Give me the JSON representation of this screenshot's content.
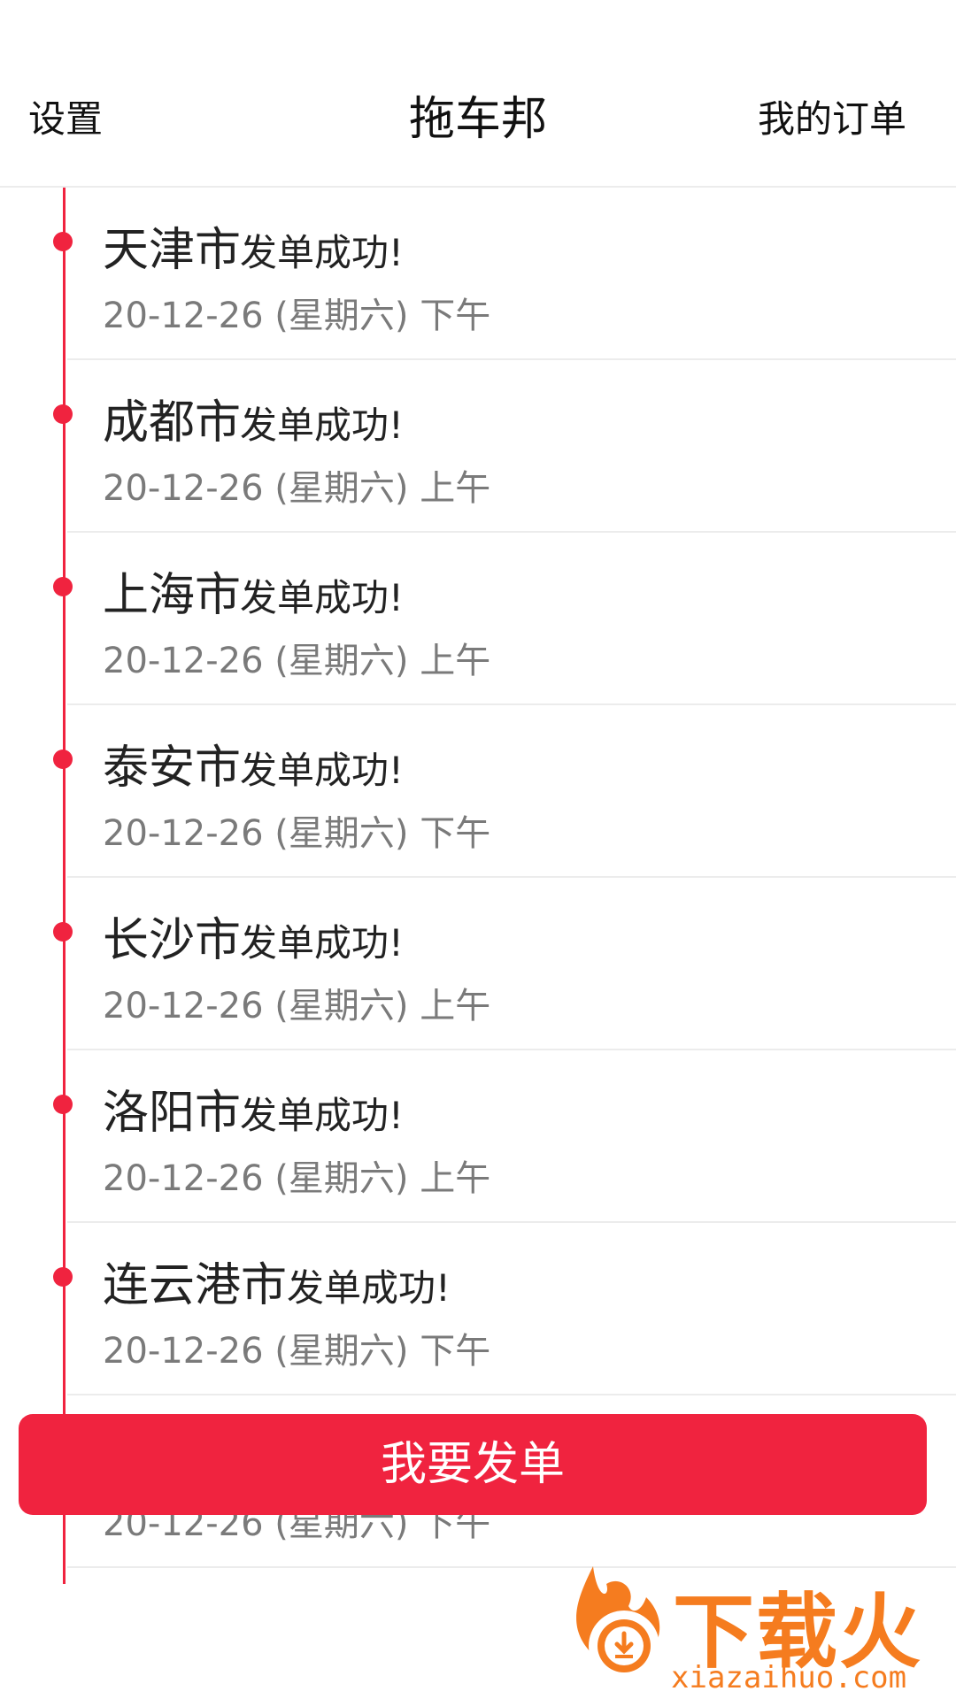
{
  "header": {
    "settings_label": "设置",
    "title": "拖车邦",
    "my_orders_label": "我的订单"
  },
  "orders": [
    {
      "city": "天津市",
      "status": "发单成功!",
      "date": "20-12-26 (星期六) 下午"
    },
    {
      "city": "成都市",
      "status": "发单成功!",
      "date": "20-12-26 (星期六) 上午"
    },
    {
      "city": "上海市",
      "status": "发单成功!",
      "date": "20-12-26 (星期六) 上午"
    },
    {
      "city": "泰安市",
      "status": "发单成功!",
      "date": "20-12-26 (星期六) 下午"
    },
    {
      "city": "长沙市",
      "status": "发单成功!",
      "date": "20-12-26 (星期六) 上午"
    },
    {
      "city": "洛阳市",
      "status": "发单成功!",
      "date": "20-12-26 (星期六) 上午"
    },
    {
      "city": "连云港市",
      "status": "发单成功!",
      "date": "20-12-26 (星期六) 下午"
    },
    {
      "city": "",
      "status": "",
      "date": "20-12-26 (星期六) 下午"
    }
  ],
  "primary_button": {
    "label": "我要发单"
  },
  "watermark": {
    "title": "下载火",
    "subtitle": "xiazaihuo.com"
  },
  "colors": {
    "accent": "#f0233f",
    "watermark": "#f57c1f",
    "date_text": "#7a7a7a"
  }
}
